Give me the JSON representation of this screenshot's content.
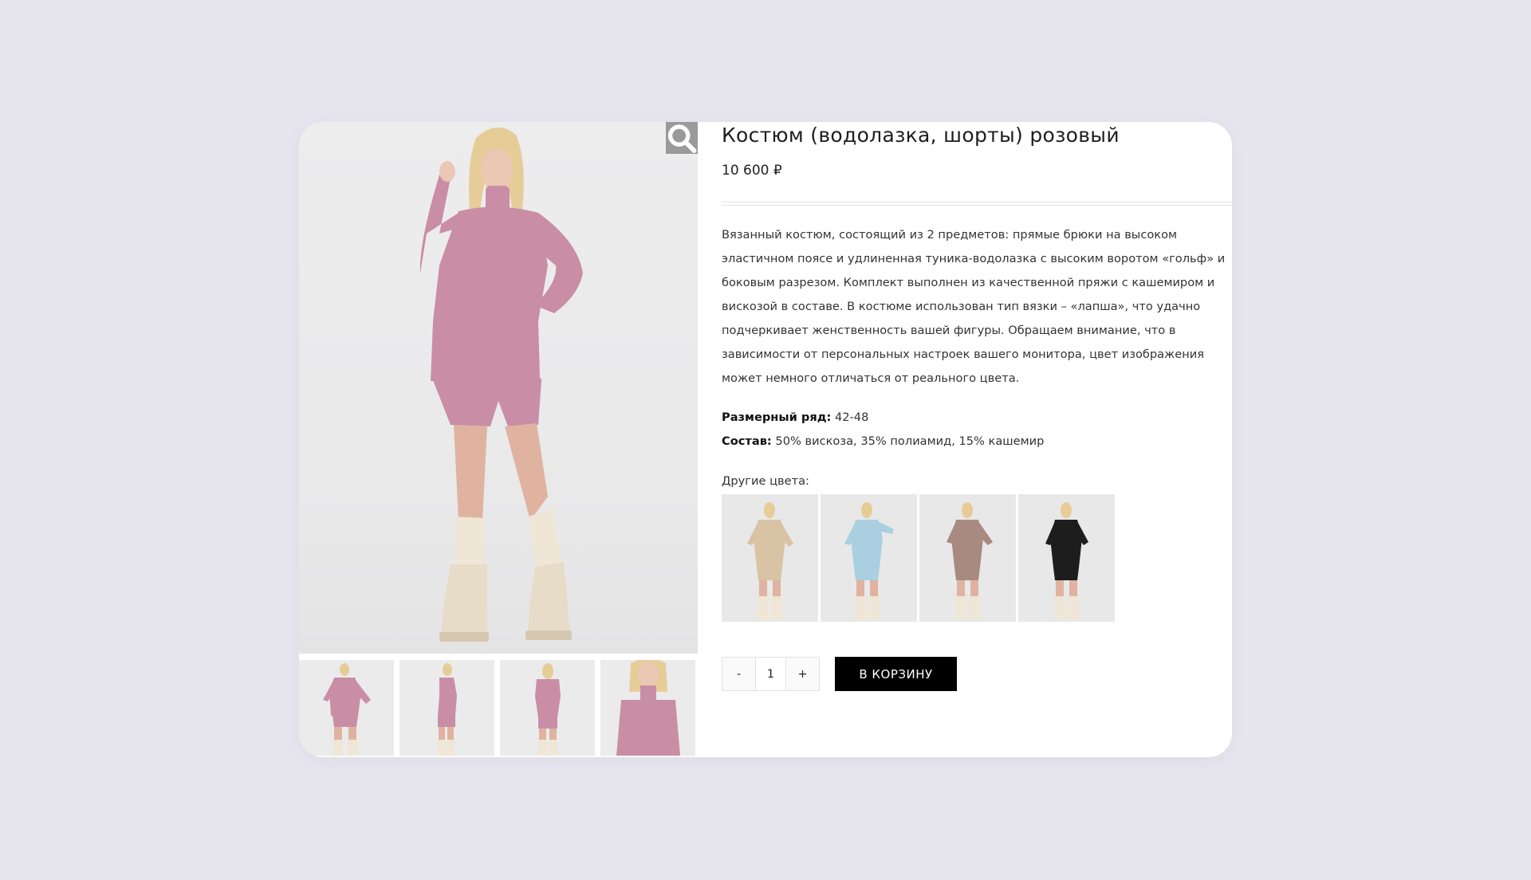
{
  "product": {
    "title": "Костюм (водолазка, шорты) розовый",
    "price": "10  600 ₽",
    "description": "Вязанный костюм, состоящий из 2 предметов: прямые брюки на высоком эластичном поясе и удлиненная туника-водолазка с высоким воротом «гольф» и боковым разрезом. Комплект выполнен из качественной пряжи с кашемиром и вискозой в составе. В костюме использован тип вязки – «лапша», что удачно подчеркивает женственность вашей фигуры. Обращаем внимание, что в зависимости от персональных настроек вашего монитора, цвет изображения может немного отличаться от реального цвета.",
    "size_label": "Размерный ряд:",
    "size_value": " 42-48",
    "composition_label": "Состав:",
    "composition_value": " 50% вискоза, 35% полиамид, 15% кашемир",
    "other_colors_label": "Другие цвета:"
  },
  "gallery": {
    "zoom_icon": "search-icon",
    "outfit_color": "#c98ea5",
    "thumbnails": [
      {
        "view": "front"
      },
      {
        "view": "side"
      },
      {
        "view": "back"
      },
      {
        "view": "closeup"
      }
    ]
  },
  "other_colors": [
    {
      "name": "beige",
      "color": "#d9c3a5"
    },
    {
      "name": "light-blue",
      "color": "#a9cfe0"
    },
    {
      "name": "mocha",
      "color": "#a98a80"
    },
    {
      "name": "black",
      "color": "#1d1d1d"
    }
  ],
  "cart": {
    "minus_label": "-",
    "quantity": "1",
    "plus_label": "+",
    "add_to_cart_label": "В КОРЗИНУ"
  }
}
